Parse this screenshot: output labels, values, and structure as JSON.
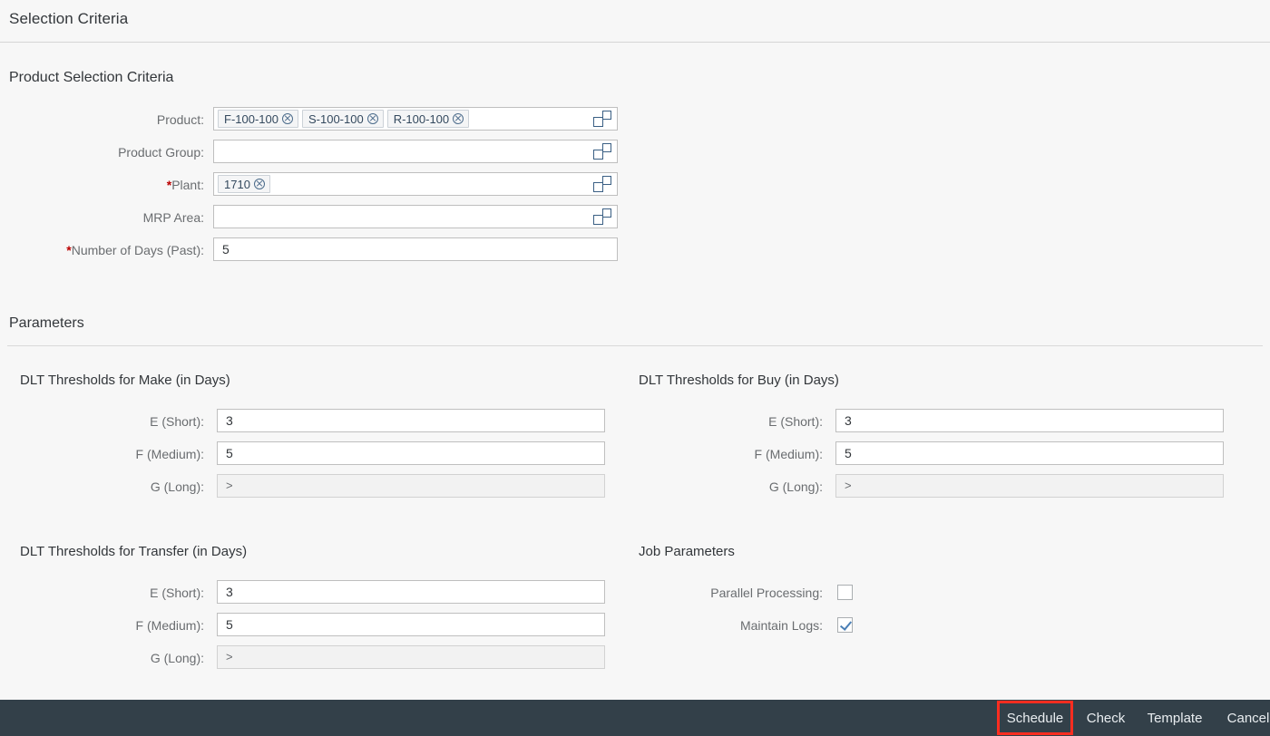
{
  "header": {
    "title": "Selection Criteria"
  },
  "product_selection": {
    "section_title": "Product Selection Criteria",
    "fields": [
      {
        "label": "Product:",
        "required": false,
        "type": "tokens",
        "tokens": [
          "F-100-100",
          "S-100-100",
          "R-100-100"
        ],
        "value_help": "value-help-icon"
      },
      {
        "label": "Product Group:",
        "required": false,
        "type": "tokens",
        "tokens": [],
        "value_help": "value-help-icon"
      },
      {
        "label": "Plant:",
        "required": true,
        "type": "tokens",
        "tokens": [
          "1710"
        ],
        "value_help": "value-help-icon"
      },
      {
        "label": "MRP Area:",
        "required": false,
        "type": "tokens",
        "tokens": [],
        "value_help": "value-help-icon"
      },
      {
        "label": "Number of Days (Past):",
        "required": true,
        "type": "text",
        "value": "5"
      }
    ]
  },
  "parameters": {
    "section_title": "Parameters",
    "groups": [
      {
        "title": "DLT Thresholds for Make (in Days)",
        "rows": [
          {
            "label": "E (Short):",
            "value": "3",
            "disabled": false
          },
          {
            "label": "F (Medium):",
            "value": "5",
            "disabled": false
          },
          {
            "label": "G (Long):",
            "value": ">",
            "disabled": true
          }
        ]
      },
      {
        "title": "DLT Thresholds for Buy (in Days)",
        "rows": [
          {
            "label": "E (Short):",
            "value": "3",
            "disabled": false
          },
          {
            "label": "F (Medium):",
            "value": "5",
            "disabled": false
          },
          {
            "label": "G (Long):",
            "value": ">",
            "disabled": true
          }
        ]
      },
      {
        "title": "DLT Thresholds for Transfer (in Days)",
        "rows": [
          {
            "label": "E (Short):",
            "value": "3",
            "disabled": false
          },
          {
            "label": "F (Medium):",
            "value": "5",
            "disabled": false
          },
          {
            "label": "G (Long):",
            "value": ">",
            "disabled": true
          }
        ]
      }
    ],
    "job_parameters": {
      "title": "Job Parameters",
      "rows": [
        {
          "label": "Parallel Processing:",
          "checked": false
        },
        {
          "label": "Maintain Logs:",
          "checked": true
        }
      ]
    }
  },
  "footer": {
    "buttons": [
      {
        "label": "Schedule",
        "highlighted": true
      },
      {
        "label": "Check",
        "highlighted": false
      },
      {
        "label": "Template",
        "highlighted": false
      },
      {
        "label": "Cancel",
        "highlighted": false
      }
    ],
    "highlight_color": "#ff2d20",
    "bar_color": "#334049"
  }
}
